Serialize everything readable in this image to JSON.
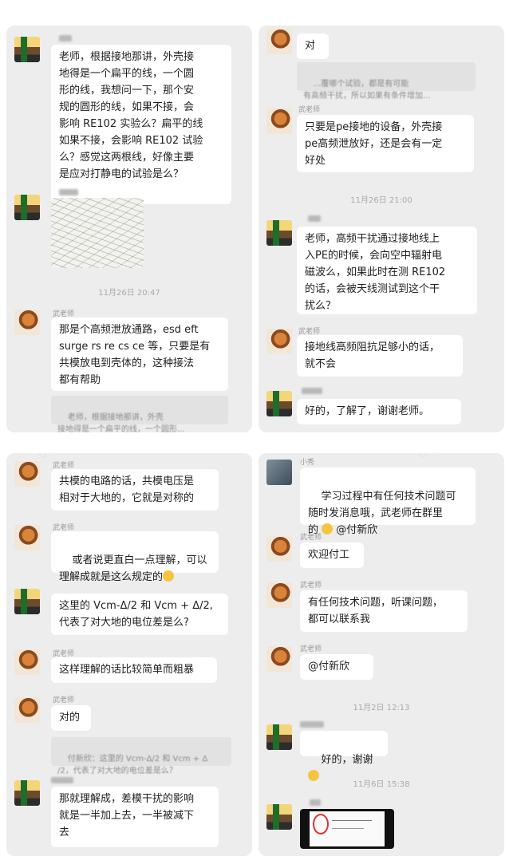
{
  "panels": {
    "p1": {
      "messages": [
        {
          "text": "老师，根据接地那讲，外壳接\n地得是一个扁平的线，一个圆\n形的线，我想问一下，那个安\n规的圆形的线，如果不接，会\n影响 RE102 实验么？扁平的线\n如果不接，会影响 RE102 试验\n么？感觉这两根线，好像主要\n是应对打静电的试验是么？"
        },
        {
          "text": "那是个高频泄放通路，esd eft\nsurge rs re cs ce 等，只要是有\n共模放电到壳体的，这种接法\n都有帮助"
        }
      ],
      "time": "11月26日 20:47",
      "sender": "武老师",
      "quote": "老师，根据接地那讲，外壳\n接地得是一个扁平的线，一个圆形..."
    },
    "p2": {
      "messages": [
        {
          "text": "对"
        },
        {
          "text": "只要是pe接地的设备，外壳接\npe高频泄放好，还是会有一定\n好处"
        },
        {
          "text": "老师，高频干扰通过接地线上\n入PE的时候，会向空中辐射电\n磁波么，如果此时在测 RE102\n的话，会被天线测试到这个干\n扰么？"
        },
        {
          "text": "接地线高频阻抗足够小的话，\n就不会"
        },
        {
          "text": "好的，了解了，谢谢老师。"
        }
      ],
      "quote": "...覆哪个试验，都是有可能\n有高频干扰，所以如果有条件增加...",
      "sender": "武老师",
      "time": "11月26日 21:00"
    },
    "p3": {
      "messages": [
        {
          "text": "共模的电路的话，共模电压是\n相对于大地的，它就是对称的"
        },
        {
          "text": "或者说更直白一点理解，可以\n理解成就是这么规定的"
        },
        {
          "text": "这里的 Vcm-Δ/2 和 Vcm + Δ/2,\n代表了对大地的电位差是么?"
        },
        {
          "text": "这样理解的话比较简单而粗暴"
        },
        {
          "text": "对的"
        },
        {
          "text": "那就理解成，差模干扰的影响\n就是一半加上去，一半被减下\n去"
        }
      ],
      "sender": "武老师",
      "quote": "付新欣：这里的 Vcm-Δ/2 和 Vcm + Δ\n/2，代表了对大地的电位差是么？"
    },
    "p4": {
      "messages": [
        {
          "text": "学习过程中有任何技术问题可\n随时发消息哦，武老师在群里\n的 "
        },
        {
          "mention": "@付新欣"
        },
        {
          "text": "欢迎付工"
        },
        {
          "text": "有任何技术问题，听课问题，\n都可以联系我"
        },
        {
          "text": "@付新欣"
        },
        {
          "text": "好的，谢谢"
        }
      ],
      "sender_top": "小秀",
      "sender": "武老师",
      "time1": "11月2日 12:13",
      "time2": "11月6日 15:38"
    }
  },
  "colors": {
    "panel_bg": "#ededed",
    "bubble_bg": "#ffffff",
    "meta_text": "#9a9a9a"
  }
}
